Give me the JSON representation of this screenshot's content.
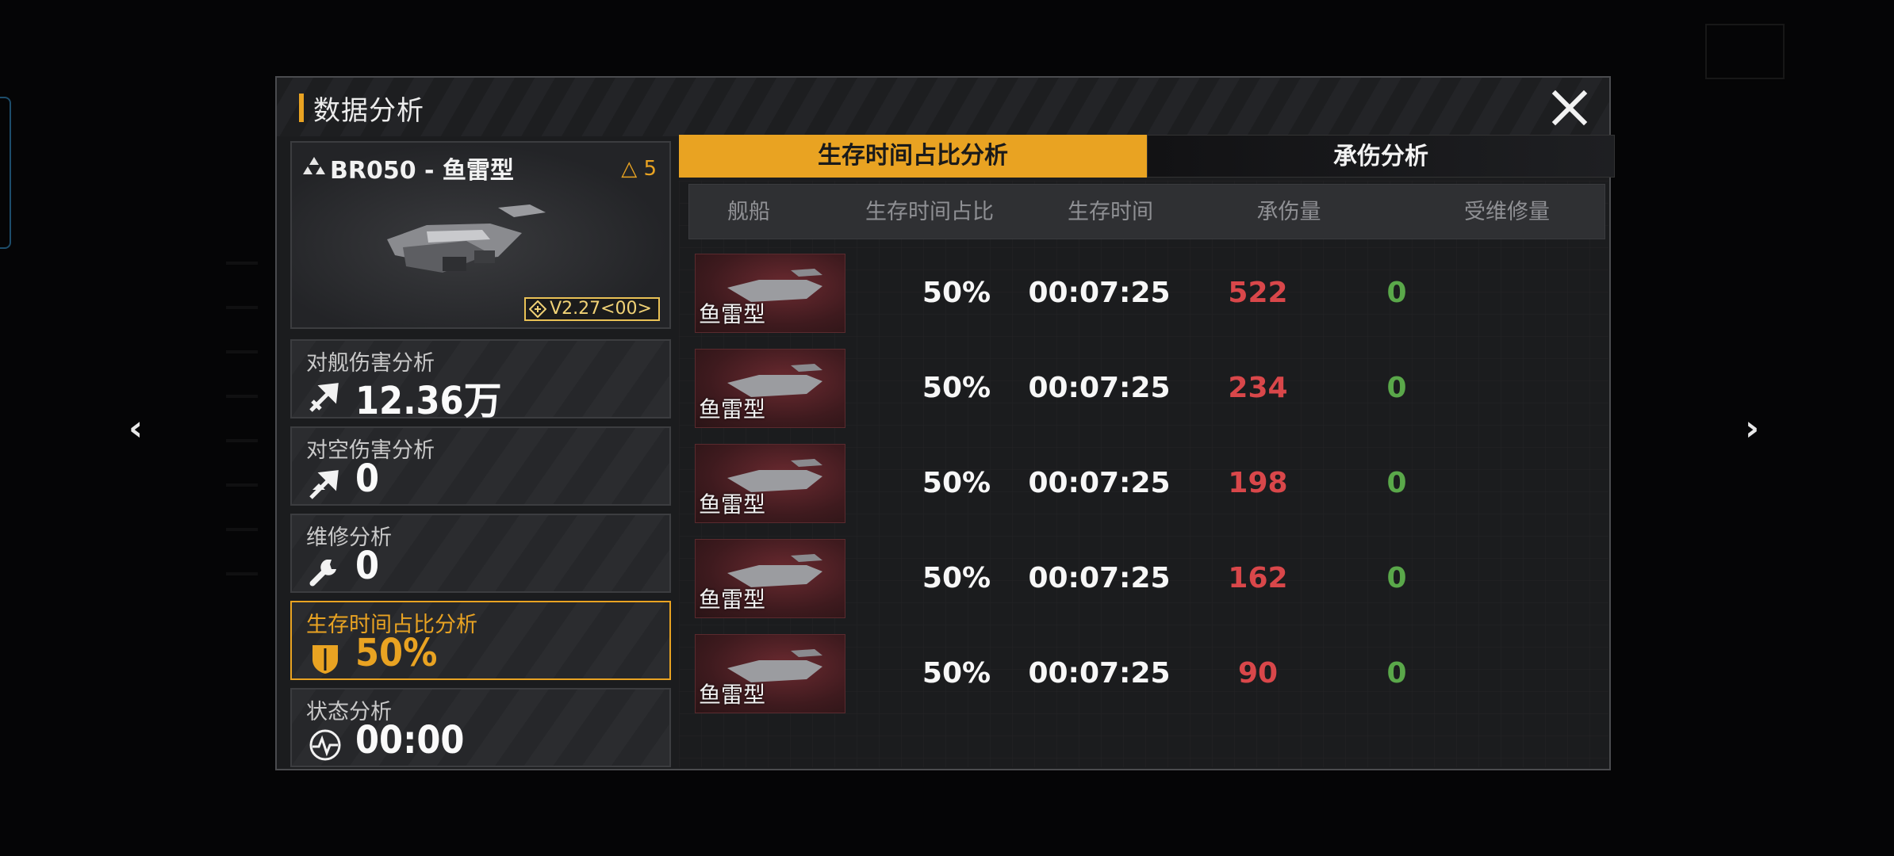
{
  "dialog": {
    "title": "数据分析"
  },
  "ship": {
    "name": "BR050 - 鱼雷型",
    "level": "△ 5",
    "version": "V2.27<00>"
  },
  "stats": [
    {
      "label": "对舰伤害分析",
      "value": "12.36万",
      "icon": "anti-ship-damage-icon"
    },
    {
      "label": "对空伤害分析",
      "value": "0",
      "icon": "anti-air-damage-icon"
    },
    {
      "label": "维修分析",
      "value": "0",
      "icon": "wrench-icon"
    },
    {
      "label": "生存时间占比分析",
      "value": "50%",
      "icon": "shield-icon"
    },
    {
      "label": "状态分析",
      "value": "00:00",
      "icon": "status-pulse-icon"
    }
  ],
  "tabs": [
    {
      "label": "生存时间占比分析",
      "active": true
    },
    {
      "label": "承伤分析",
      "active": false
    }
  ],
  "table": {
    "headers": [
      "舰船",
      "生存时间占比",
      "生存时间",
      "承伤量",
      "受维修量"
    ],
    "rows": [
      {
        "ship": "鱼雷型",
        "pct": "50%",
        "time": "00:07:25",
        "damage_taken": "522",
        "repaired": "0"
      },
      {
        "ship": "鱼雷型",
        "pct": "50%",
        "time": "00:07:25",
        "damage_taken": "234",
        "repaired": "0"
      },
      {
        "ship": "鱼雷型",
        "pct": "50%",
        "time": "00:07:25",
        "damage_taken": "198",
        "repaired": "0"
      },
      {
        "ship": "鱼雷型",
        "pct": "50%",
        "time": "00:07:25",
        "damage_taken": "162",
        "repaired": "0"
      },
      {
        "ship": "鱼雷型",
        "pct": "50%",
        "time": "00:07:25",
        "damage_taken": "90",
        "repaired": "0"
      }
    ]
  },
  "nav": {
    "prev": "‹",
    "next": "›"
  },
  "colors": {
    "accent": "#e9a322",
    "damage": "#d9474a",
    "repair": "#5aa84a"
  }
}
